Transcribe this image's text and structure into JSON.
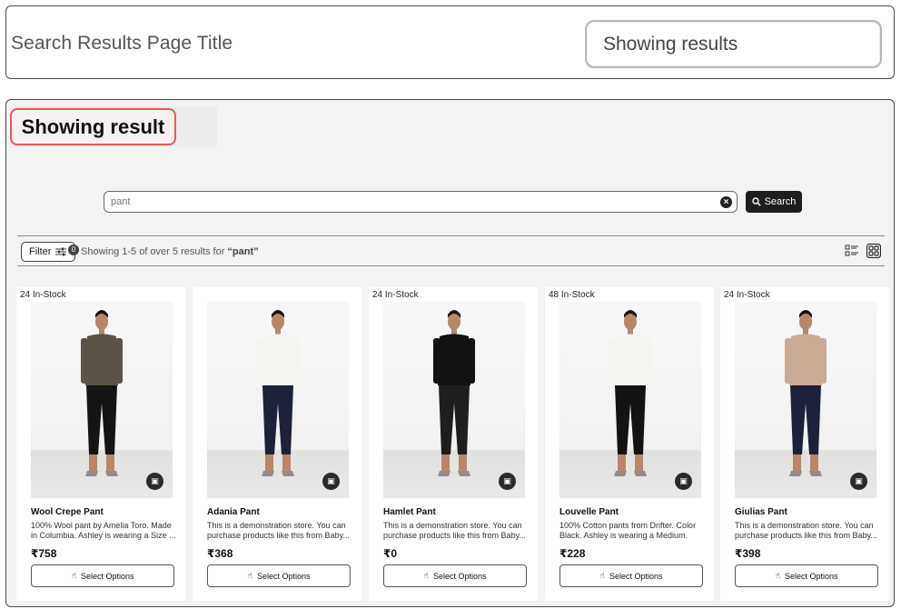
{
  "top_panel": {
    "title": "Search Results Page Title",
    "chip": "Showing results"
  },
  "heading": "Showing result",
  "search": {
    "value": "pant",
    "button_label": "Search"
  },
  "toolbar": {
    "filter_label": "Filter",
    "filter_count": "0",
    "result_prefix": "Showing 1-5 of over 5 results for",
    "result_query": "“pant”",
    "view_icons": [
      "list-view-icon",
      "grid-view-icon"
    ]
  },
  "products": [
    {
      "stock": "24 In-Stock",
      "name": "Wool Crepe Pant",
      "description": "100% Wool pant by Amelia Toro. Made in Columbia. Ashley is wearing a Size ...",
      "price": "₹758",
      "button": "Select Options",
      "top_color": "#5b5347",
      "bottom_color": "#141414"
    },
    {
      "stock": "",
      "name": "Adania Pant",
      "description": "This is a demonstration store. You can purchase products like this from Baby...",
      "price": "₹368",
      "button": "Select Options",
      "top_color": "#f4f3ef",
      "bottom_color": "#1d2238"
    },
    {
      "stock": "24 In-Stock",
      "name": "Hamlet Pant",
      "description": "This is a demonstration store. You can purchase products like this from Baby...",
      "price": "₹0",
      "button": "Select Options",
      "top_color": "#121212",
      "bottom_color": "#1e1e1e"
    },
    {
      "stock": "48 In-Stock",
      "name": "Louvelle Pant",
      "description": "100% Cotton pants from Drifter. Color Black. Ashley is wearing a Medium.",
      "price": "₹228",
      "button": "Select Options",
      "top_color": "#f4f3ef",
      "bottom_color": "#131313"
    },
    {
      "stock": "24 In-Stock",
      "name": "Giulias Pant",
      "description": "This is a demonstration store. You can purchase products like this from Baby...",
      "price": "₹398",
      "button": "Select Options",
      "top_color": "#c9ab93",
      "bottom_color": "#1b2138"
    }
  ]
}
